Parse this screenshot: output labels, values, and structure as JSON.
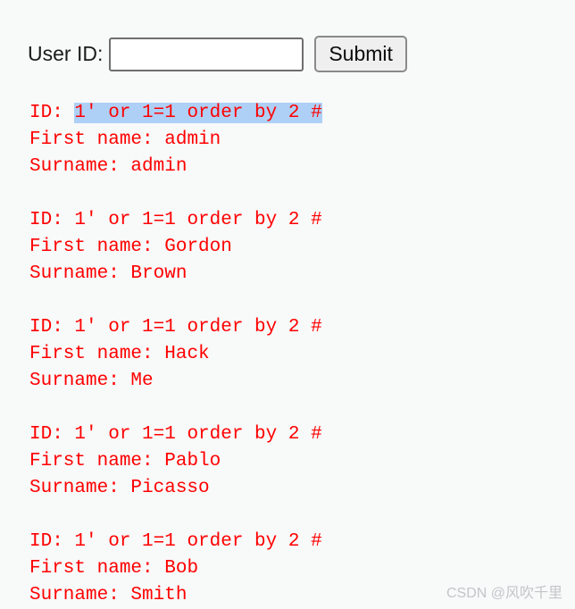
{
  "form": {
    "label": "User ID:",
    "input_value": "",
    "input_placeholder": "",
    "submit_label": "Submit"
  },
  "labels": {
    "id_prefix": "ID: ",
    "first_name_prefix": "First name: ",
    "surname_prefix": "Surname: "
  },
  "results": [
    {
      "id_value": "1' or 1=1 order by 2 #",
      "id_selected": true,
      "first_name": "admin",
      "surname": "admin"
    },
    {
      "id_value": "1' or 1=1 order by 2 #",
      "id_selected": false,
      "first_name": "Gordon",
      "surname": "Brown"
    },
    {
      "id_value": "1' or 1=1 order by 2 #",
      "id_selected": false,
      "first_name": "Hack",
      "surname": "Me"
    },
    {
      "id_value": "1' or 1=1 order by 2 #",
      "id_selected": false,
      "first_name": "Pablo",
      "surname": "Picasso"
    },
    {
      "id_value": "1' or 1=1 order by 2 #",
      "id_selected": false,
      "first_name": "Bob",
      "surname": "Smith"
    }
  ],
  "watermark": {
    "text": "CSDN @风吹千里"
  },
  "colors": {
    "background": "#f8f9f9",
    "result_text": "#ff0000",
    "selection_highlight": "#aed0f7",
    "input_border": "#6e6e6e",
    "button_face": "#efefef",
    "button_border": "#8a8a8a",
    "watermark_text": "#c3c6c9"
  }
}
